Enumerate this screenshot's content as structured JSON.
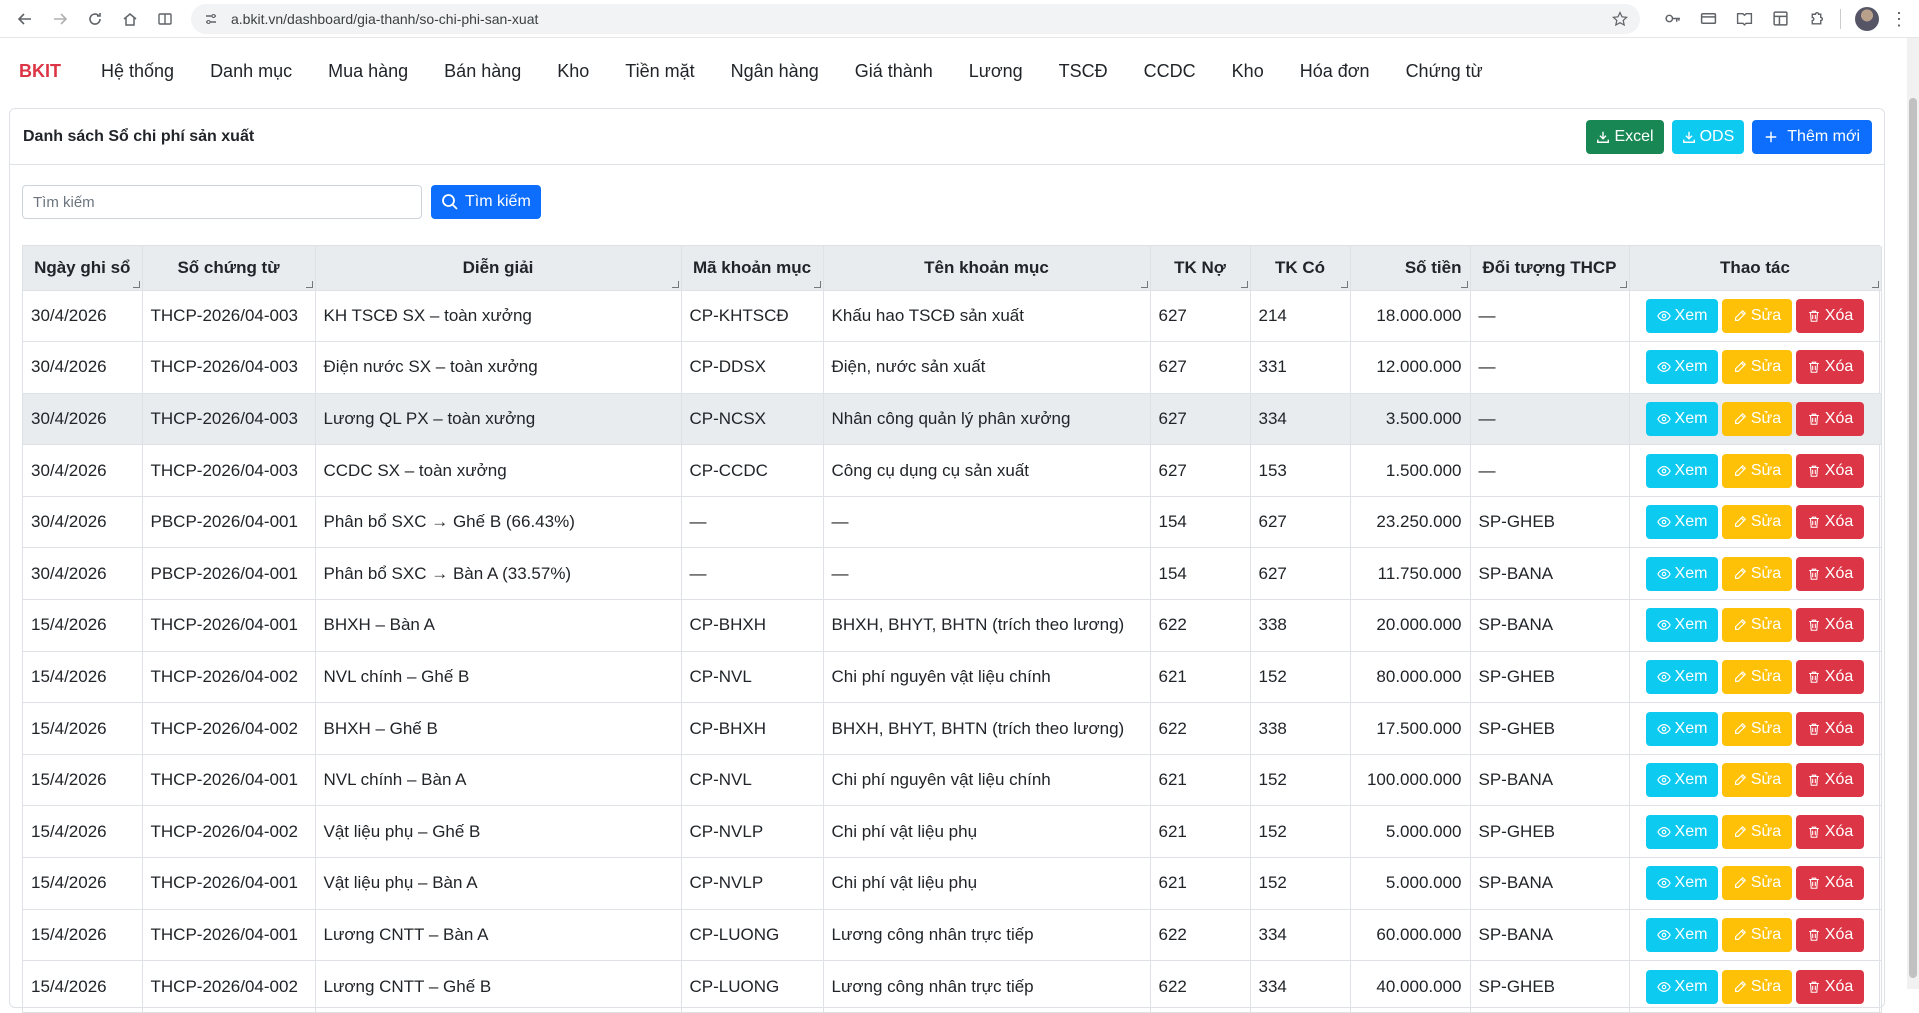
{
  "browser": {
    "url": "a.bkit.vn/dashboard/gia-thanh/so-chi-phi-san-xuat"
  },
  "nav": {
    "brand": "BKIT",
    "items": [
      "Hệ thống",
      "Danh mục",
      "Mua hàng",
      "Bán hàng",
      "Kho",
      "Tiền mặt",
      "Ngân hàng",
      "Giá thành",
      "Lương",
      "TSCĐ",
      "CCDC",
      "Kho",
      "Hóa đơn",
      "Chứng từ"
    ]
  },
  "page": {
    "title": "Danh sách Sổ chi phí sản xuất",
    "excel_label": "Excel",
    "ods_label": "ODS",
    "add_label": "Thêm mới",
    "search_placeholder": "Tìm kiếm",
    "search_button": "Tìm kiếm"
  },
  "table": {
    "headers": [
      "Ngày ghi sổ",
      "Số chứng từ",
      "Diễn giải",
      "Mã khoản mục",
      "Tên khoản mục",
      "TK Nợ",
      "TK Có",
      "Số tiền",
      "Đối tượng THCP",
      "Thao tác"
    ],
    "actions": {
      "view": "Xem",
      "edit": "Sửa",
      "delete": "Xóa"
    },
    "rows": [
      [
        "30/4/2026",
        "THCP-2026/04-003",
        "KH TSCĐ SX – toàn xưởng",
        "CP-KHTSCĐ",
        "Khấu hao TSCĐ sản xuất",
        "627",
        "214",
        "18.000.000",
        "—"
      ],
      [
        "30/4/2026",
        "THCP-2026/04-003",
        "Điện nước SX – toàn xưởng",
        "CP-DDSX",
        "Điện, nước sản xuất",
        "627",
        "331",
        "12.000.000",
        "—"
      ],
      [
        "30/4/2026",
        "THCP-2026/04-003",
        "Lương QL PX – toàn xưởng",
        "CP-NCSX",
        "Nhân công quản lý phân xưởng",
        "627",
        "334",
        "3.500.000",
        "—"
      ],
      [
        "30/4/2026",
        "THCP-2026/04-003",
        "CCDC SX – toàn xưởng",
        "CP-CCDC",
        "Công cụ dụng cụ sản xuất",
        "627",
        "153",
        "1.500.000",
        "—"
      ],
      [
        "30/4/2026",
        "PBCP-2026/04-001",
        "Phân bổ SXC → Ghế B (66.43%)",
        "—",
        "—",
        "154",
        "627",
        "23.250.000",
        "SP-GHEB"
      ],
      [
        "30/4/2026",
        "PBCP-2026/04-001",
        "Phân bổ SXC → Bàn A (33.57%)",
        "—",
        "—",
        "154",
        "627",
        "11.750.000",
        "SP-BANA"
      ],
      [
        "15/4/2026",
        "THCP-2026/04-001",
        "BHXH – Bàn A",
        "CP-BHXH",
        "BHXH, BHYT, BHTN (trích theo lương)",
        "622",
        "338",
        "20.000.000",
        "SP-BANA"
      ],
      [
        "15/4/2026",
        "THCP-2026/04-002",
        "NVL chính – Ghế B",
        "CP-NVL",
        "Chi phí nguyên vật liệu chính",
        "621",
        "152",
        "80.000.000",
        "SP-GHEB"
      ],
      [
        "15/4/2026",
        "THCP-2026/04-002",
        "BHXH – Ghế B",
        "CP-BHXH",
        "BHXH, BHYT, BHTN (trích theo lương)",
        "622",
        "338",
        "17.500.000",
        "SP-GHEB"
      ],
      [
        "15/4/2026",
        "THCP-2026/04-001",
        "NVL chính – Bàn A",
        "CP-NVL",
        "Chi phí nguyên vật liệu chính",
        "621",
        "152",
        "100.000.000",
        "SP-BANA"
      ],
      [
        "15/4/2026",
        "THCP-2026/04-002",
        "Vật liệu phụ – Ghế B",
        "CP-NVLP",
        "Chi phí vật liệu phụ",
        "621",
        "152",
        "5.000.000",
        "SP-GHEB"
      ],
      [
        "15/4/2026",
        "THCP-2026/04-001",
        "Vật liệu phụ – Bàn A",
        "CP-NVLP",
        "Chi phí vật liệu phụ",
        "621",
        "152",
        "5.000.000",
        "SP-BANA"
      ],
      [
        "15/4/2026",
        "THCP-2026/04-001",
        "Lương CNTT – Bàn A",
        "CP-LUONG",
        "Lương công nhân trực tiếp",
        "622",
        "334",
        "60.000.000",
        "SP-BANA"
      ],
      [
        "15/4/2026",
        "THCP-2026/04-002",
        "Lương CNTT – Ghế B",
        "CP-LUONG",
        "Lương công nhân trực tiếp",
        "622",
        "334",
        "40.000.000",
        "SP-GHEB"
      ]
    ]
  }
}
